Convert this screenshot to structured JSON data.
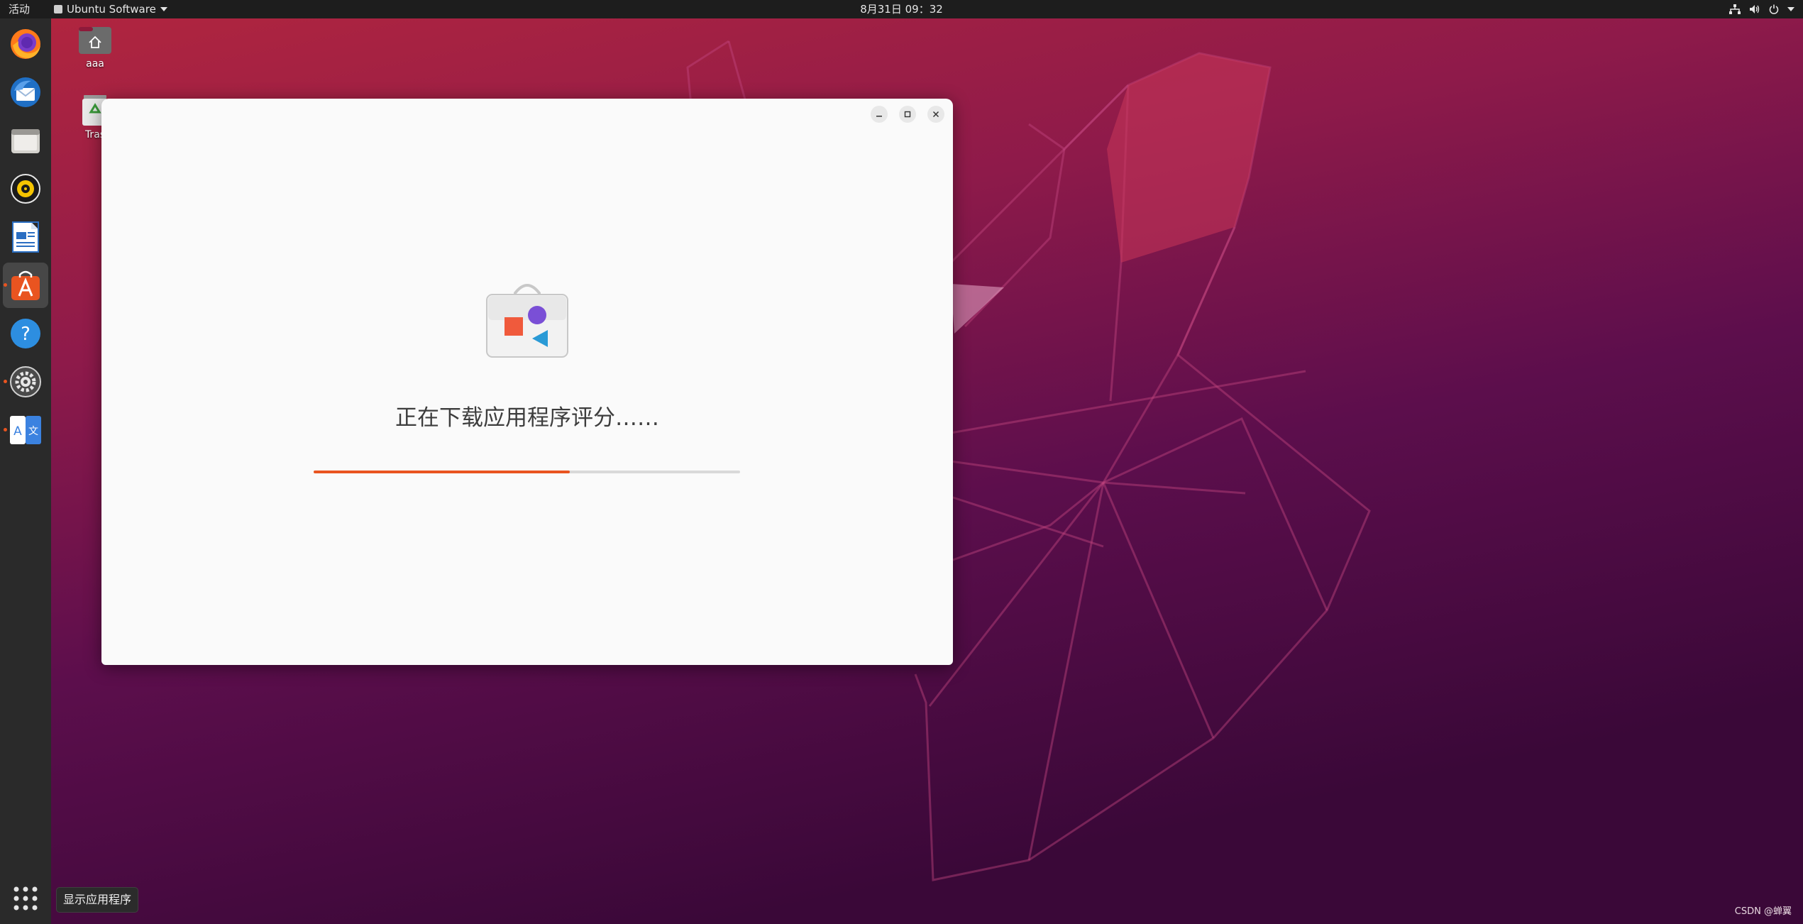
{
  "topbar": {
    "activities": "活动",
    "app_menu": "Ubuntu Software",
    "clock": "8月31日  09：32"
  },
  "desktop": {
    "icons": [
      {
        "label": "aaa"
      },
      {
        "label": "Tras"
      }
    ]
  },
  "window": {
    "loading_text": "正在下载应用程序评分……",
    "progress_fraction": 0.6
  },
  "dock": {
    "tooltip": "显示应用程序"
  },
  "watermark": "CSDN @蝉翼",
  "colors": {
    "accent": "#e95420",
    "topbar": "#1d1d1d",
    "dock": "#2a2a2a"
  }
}
